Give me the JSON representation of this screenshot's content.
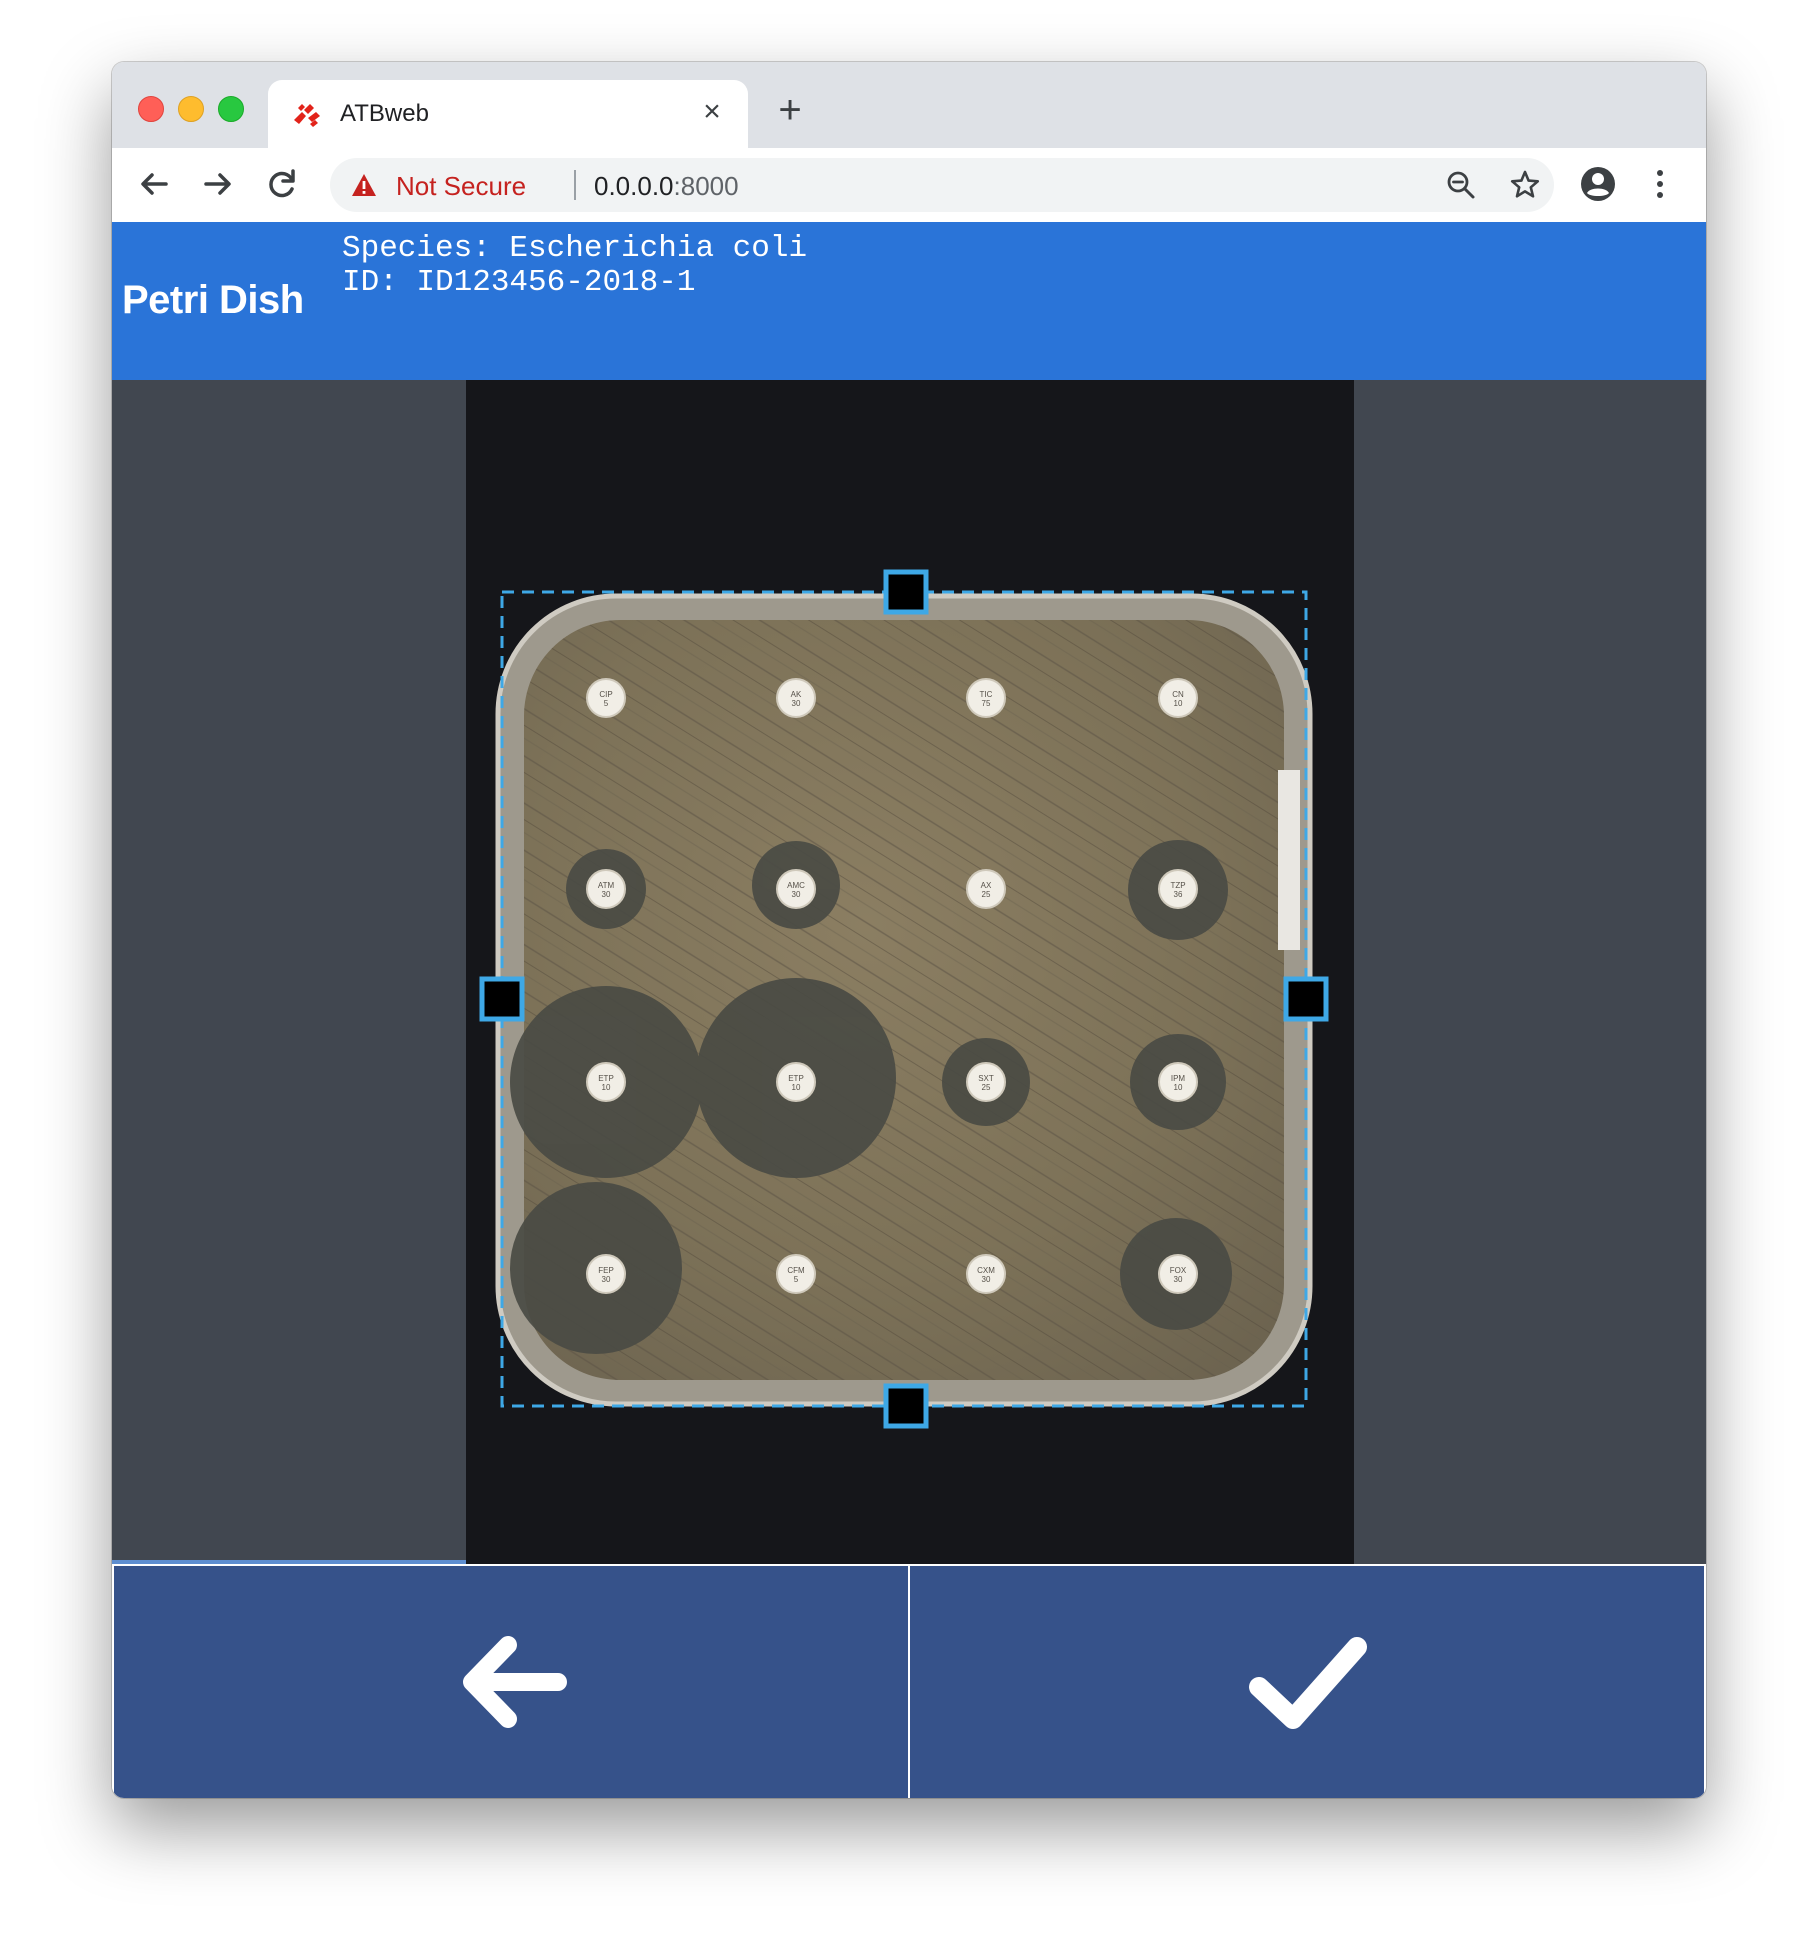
{
  "browser": {
    "tab_title": "ATBweb",
    "tab_close": "×",
    "new_tab": "+",
    "security_label": "Not Secure",
    "url_host": "0.0.0.0",
    "url_port": ":8000"
  },
  "app": {
    "title": "Petri Dish",
    "species_line": "Species: Escherichia coli",
    "id_line": "ID: ID123456-2018-1"
  },
  "disks": [
    {
      "label": "CIP 5"
    },
    {
      "label": "AK 30"
    },
    {
      "label": "TIC 75"
    },
    {
      "label": "CN 10"
    },
    {
      "label": "ATM 30"
    },
    {
      "label": "AMC 30"
    },
    {
      "label": "AX 25"
    },
    {
      "label": "TZP 36"
    },
    {
      "label": "ETP 10"
    },
    {
      "label": "ETP 10"
    },
    {
      "label": "SXT 25"
    },
    {
      "label": "IPM 10"
    },
    {
      "label": "FEP 30"
    },
    {
      "label": "CFM 5"
    },
    {
      "label": "CXM 30"
    },
    {
      "label": "FOX 30"
    }
  ],
  "colors": {
    "header": "#2a74d8",
    "workspace": "#414750",
    "button": "#36528a",
    "crop_outline": "#3ea8e6"
  },
  "icons": {
    "back_button": "arrow-left-icon",
    "confirm_button": "checkmark-icon"
  }
}
